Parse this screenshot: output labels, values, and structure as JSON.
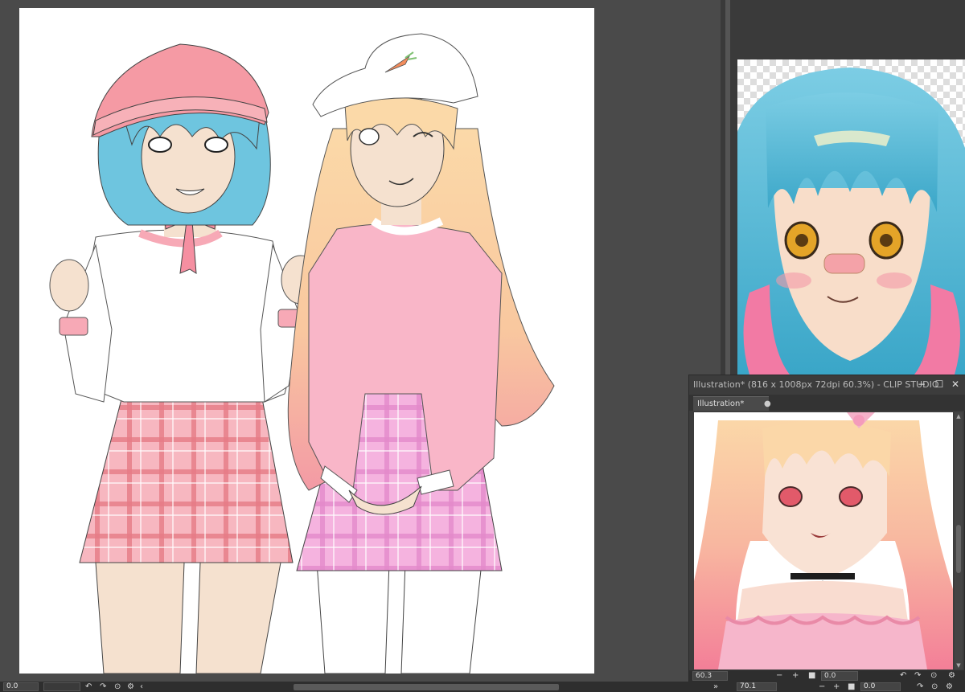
{
  "subwindow": {
    "title": "Illustration* (816 x 1008px 72dpi 60.3%)  - CLIP STUDIO",
    "tab_label": "Illustration*",
    "tab_dot": "●",
    "zoom_value": "60.3",
    "minus": "−",
    "plus": "+",
    "angle_value": "0.0",
    "icons": [
      "minimize-icon",
      "maximize-icon",
      "close-icon",
      "rotate-left-icon",
      "rotate-right-icon",
      "reset-icon",
      "settings-icon"
    ]
  },
  "status": {
    "main_zoom_value": "0.0",
    "right_zoom_value": "70.1",
    "right_angle_value": "0.0",
    "minus": "−",
    "plus": "+",
    "arrow_left": "‹",
    "arrow_right": "»"
  },
  "colors": {
    "panel_bg": "#3a3a3a",
    "canvas_bg": "#ffffff",
    "scroll_thumb": "#5a5a5a"
  }
}
